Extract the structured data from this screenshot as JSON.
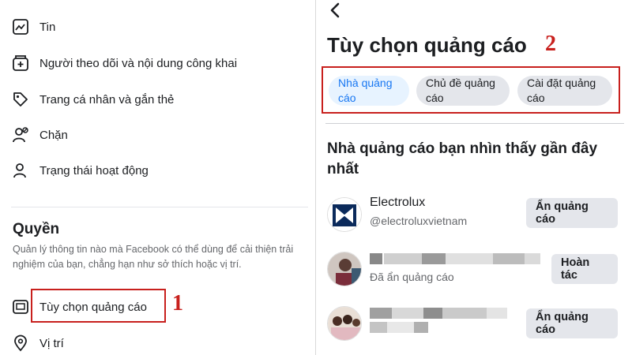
{
  "left_menu": {
    "items": [
      {
        "label": "Tin",
        "icon": "stories-icon"
      },
      {
        "label": "Người theo dõi và nội dung công khai",
        "icon": "follower-icon"
      },
      {
        "label": "Trang cá nhân và gắn thẻ",
        "icon": "tag-icon"
      },
      {
        "label": "Chặn",
        "icon": "block-user-icon"
      },
      {
        "label": "Trạng thái hoạt động",
        "icon": "active-status-icon"
      }
    ],
    "permissions": {
      "title": "Quyền",
      "description": "Quản lý thông tin nào mà Facebook có thể dùng để cải thiện trải nghiệm của bạn, chẳng hạn như sở thích hoặc vị trí.",
      "items": [
        {
          "label": "Tùy chọn quảng cáo",
          "icon": "ad-preferences-icon"
        },
        {
          "label": "Vị trí",
          "icon": "location-pin-icon"
        }
      ]
    },
    "annotation_number": "1"
  },
  "ad_preferences": {
    "back_icon": "chevron-left-icon",
    "title": "Tùy chọn quảng cáo",
    "annotation_number": "2",
    "tabs": [
      {
        "label": "Nhà quảng cáo",
        "active": true
      },
      {
        "label": "Chủ đề quảng cáo",
        "active": false
      },
      {
        "label": "Cài đặt quảng cáo",
        "active": false
      }
    ],
    "section_heading": "Nhà quảng cáo bạn nhìn thấy gần đây nhất",
    "advertisers": [
      {
        "name": "Electrolux",
        "subtitle": "@electroluxvietnam",
        "button": "Ẩn quảng cáo"
      },
      {
        "name": "",
        "subtitle": "Đã ẩn quảng cáo",
        "button": "Hoàn tác"
      },
      {
        "name": "",
        "subtitle": "",
        "button": "Ẩn quảng cáo"
      }
    ]
  },
  "colors": {
    "accent": "#1877f2",
    "annotation_red": "#c8201d",
    "chip_active_bg": "#e7f3ff",
    "button_bg": "#e4e6eb"
  }
}
